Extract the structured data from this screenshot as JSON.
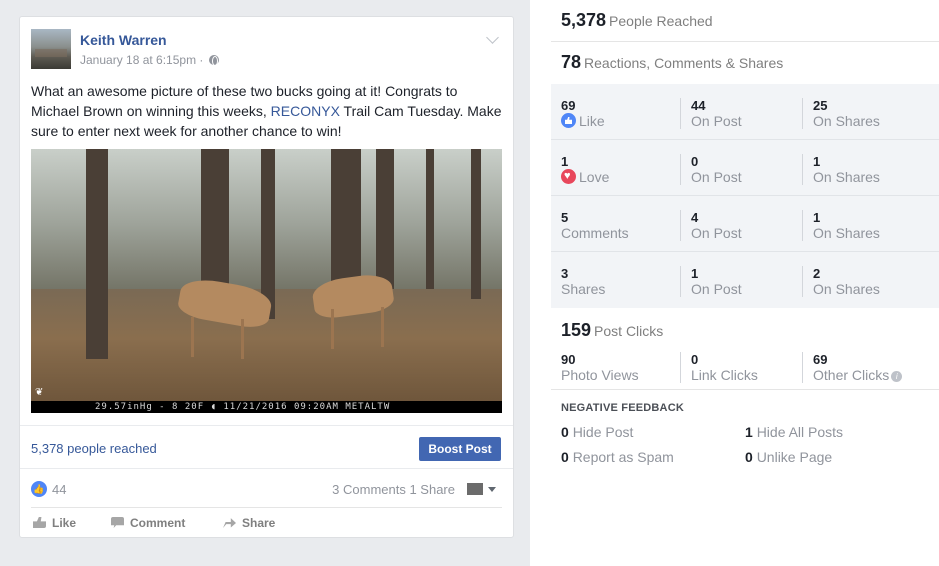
{
  "post": {
    "author": "Keith Warren",
    "timestamp": "January 18 at 6:15pm",
    "text_before": "What an awesome picture of these two bucks going at it! Congrats to Michael Brown on winning this weeks, ",
    "text_link": "RECONYX",
    "text_after": " Trail Cam Tuesday. Make sure to enter next week for another chance to win!",
    "photo_stamp": "29.57inHg -  8 20F ◖ 11/21/2016 09:20AM METALTW",
    "reached_link": "5,378 people reached",
    "boost_label": "Boost Post",
    "like_count": "44",
    "engagement": "3 Comments  1 Share",
    "actions": {
      "like": "Like",
      "comment": "Comment",
      "share": "Share"
    }
  },
  "insights": {
    "people_reached": {
      "value": "5,378",
      "label": "People Reached"
    },
    "engagement": {
      "value": "78",
      "label": "Reactions, Comments & Shares"
    },
    "rows": [
      {
        "total": "69",
        "total_label": "Like",
        "icon": "like-icon",
        "on_post": "44",
        "on_post_label": "On Post",
        "on_shares": "25",
        "on_shares_label": "On Shares"
      },
      {
        "total": "1",
        "total_label": "Love",
        "icon": "love-icon",
        "on_post": "0",
        "on_post_label": "On Post",
        "on_shares": "1",
        "on_shares_label": "On Shares"
      },
      {
        "total": "5",
        "total_label": "Comments",
        "icon": "",
        "on_post": "4",
        "on_post_label": "On Post",
        "on_shares": "1",
        "on_shares_label": "On Shares"
      },
      {
        "total": "3",
        "total_label": "Shares",
        "icon": "",
        "on_post": "1",
        "on_post_label": "On Post",
        "on_shares": "2",
        "on_shares_label": "On Shares"
      }
    ],
    "post_clicks": {
      "value": "159",
      "label": "Post Clicks"
    },
    "clicks": [
      {
        "value": "90",
        "label": "Photo Views"
      },
      {
        "value": "0",
        "label": "Link Clicks"
      },
      {
        "value": "69",
        "label": "Other Clicks"
      }
    ],
    "negative_title": "NEGATIVE FEEDBACK",
    "negative": [
      {
        "value": "0",
        "label": "Hide Post"
      },
      {
        "value": "1",
        "label": "Hide All Posts"
      },
      {
        "value": "0",
        "label": "Report as Spam"
      },
      {
        "value": "0",
        "label": "Unlike Page"
      }
    ]
  }
}
